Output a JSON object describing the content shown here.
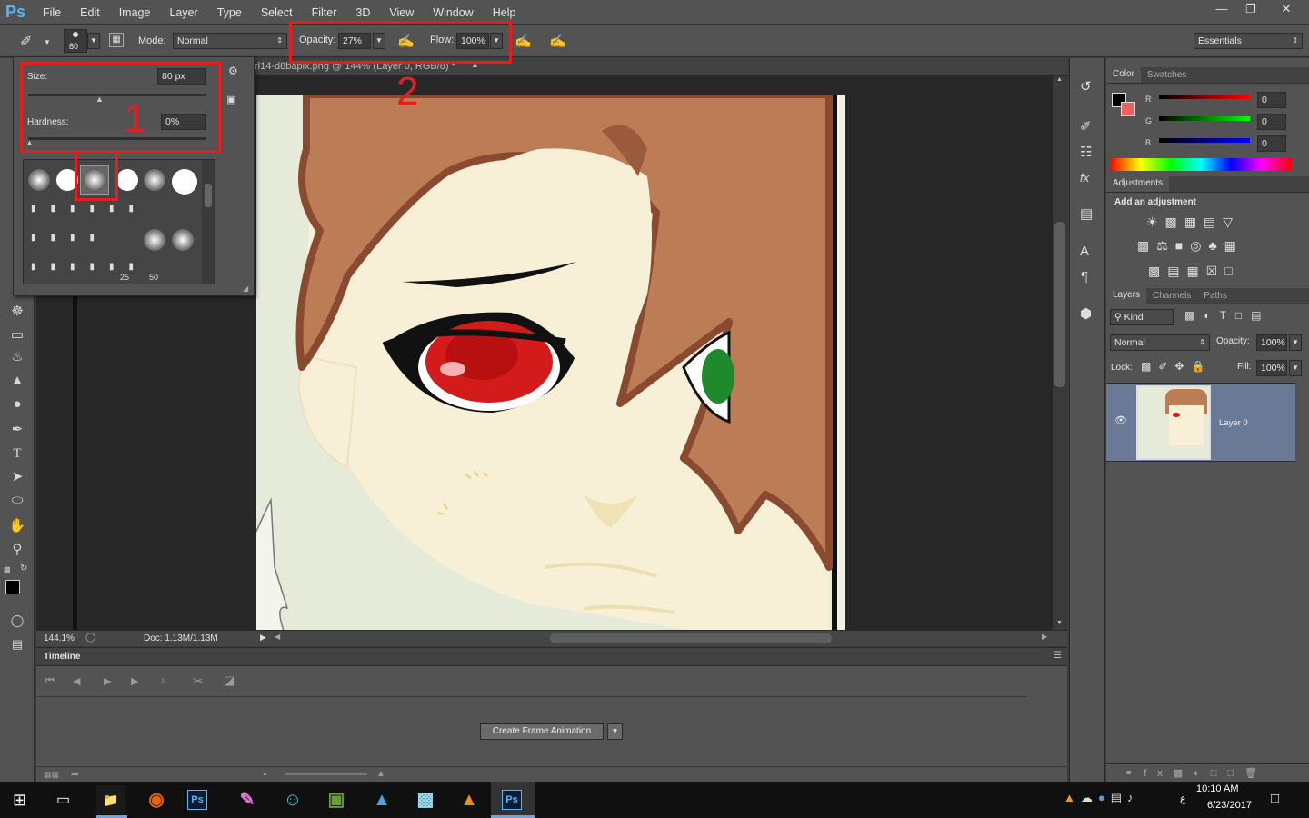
{
  "app": {
    "logo": "Ps"
  },
  "menu": [
    "File",
    "Edit",
    "Image",
    "Layer",
    "Type",
    "Select",
    "Filter",
    "3D",
    "View",
    "Window",
    "Help"
  ],
  "window_controls": [
    "minimize",
    "restore",
    "close"
  ],
  "options_bar": {
    "brush_size": "80",
    "mode_label": "Mode:",
    "mode_value": "Normal",
    "opacity_label": "Opacity:",
    "opacity_value": "27%",
    "flow_label": "Flow:",
    "flow_value": "100%",
    "workspace": "Essentials"
  },
  "annotations": {
    "one": "1",
    "two": "2"
  },
  "document": {
    "tab_title": "rl14-d8bapix.png @ 144% (Layer 0, RGB/8) *",
    "zoom": "144.1%",
    "doc_size": "Doc: 1.13M/1.13M"
  },
  "brush_popup": {
    "size_label": "Size:",
    "size_value": "80 px",
    "hardness_label": "Hardness:",
    "hardness_value": "0%",
    "preset_numbers": [
      "25",
      "50"
    ]
  },
  "timeline": {
    "title": "Timeline",
    "create_button": "Create Frame Animation"
  },
  "color_panel": {
    "tabs": [
      "Color",
      "Swatches"
    ],
    "r_label": "R",
    "g_label": "G",
    "b_label": "B",
    "r_value": "0",
    "g_value": "0",
    "b_value": "0"
  },
  "adjustments_panel": {
    "tab": "Adjustments",
    "subtitle": "Add an adjustment"
  },
  "layers_panel": {
    "tabs": [
      "Layers",
      "Channels",
      "Paths"
    ],
    "kind_filter": "Kind",
    "blend_mode": "Normal",
    "opacity_label": "Opacity:",
    "opacity_value": "100%",
    "lock_label": "Lock:",
    "fill_label": "Fill:",
    "fill_value": "100%",
    "layers": [
      {
        "name": "Layer 0"
      }
    ]
  },
  "taskbar": {
    "time": "10:10 AM",
    "date": "6/23/2017",
    "lang": "ﻉ"
  },
  "colors": {
    "accent_red": "#e02020",
    "ui_bg": "#535353",
    "selected_layer": "#6a7a96"
  }
}
